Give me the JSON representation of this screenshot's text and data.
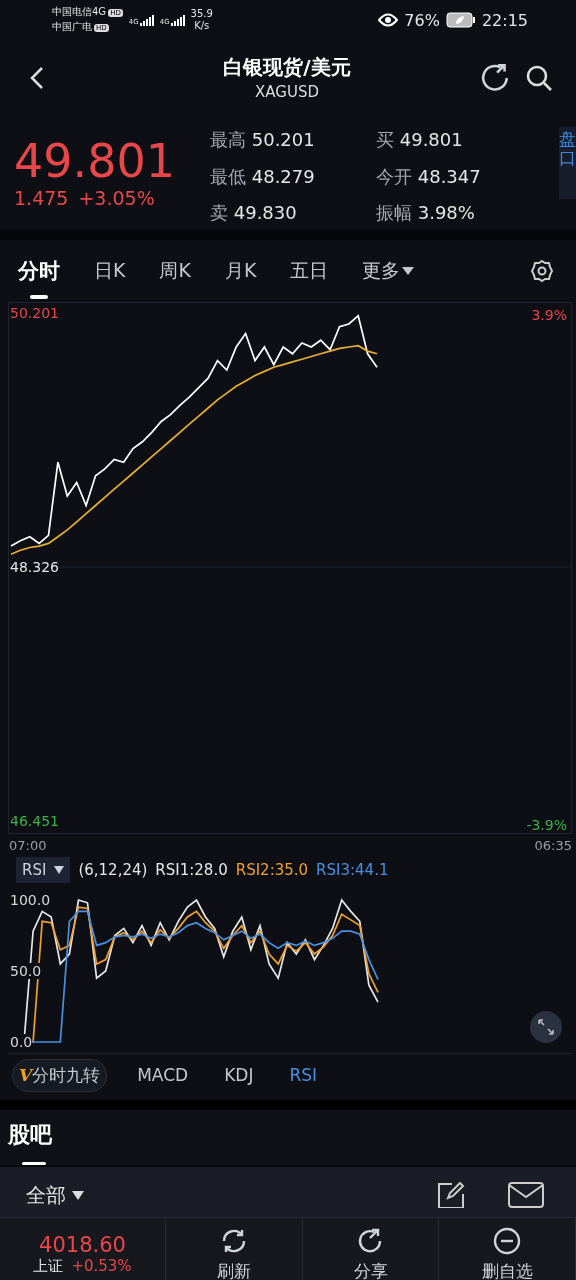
{
  "status_bar": {
    "carrier_1": "中国电信4G",
    "carrier_1_badge": "HD",
    "carrier_2": "中国广电",
    "carrier_2_badge": "HD",
    "net_1": "4G",
    "net_2": "4G",
    "speed": "35.9",
    "speed_unit": "K/s",
    "battery": "76%",
    "time": "22:15"
  },
  "header": {
    "title": "白银现货/美元",
    "subtitle": "XAGUSD"
  },
  "quote": {
    "price": "49.801",
    "change": "1.475",
    "change_pct": "+3.05%",
    "stats": [
      {
        "label": "最高",
        "value": "50.201"
      },
      {
        "label": "买",
        "value": "49.801"
      },
      {
        "label": "最低",
        "value": "48.279"
      },
      {
        "label": "今开",
        "value": "48.347"
      },
      {
        "label": "卖",
        "value": "49.830"
      },
      {
        "label": "振幅",
        "value": "3.98%"
      }
    ],
    "side_tab": "盘口"
  },
  "tabs": [
    {
      "label": "分时",
      "selected": true
    },
    {
      "label": "日K",
      "selected": false
    },
    {
      "label": "周K",
      "selected": false
    },
    {
      "label": "月K",
      "selected": false
    },
    {
      "label": "五日",
      "selected": false
    },
    {
      "label": "更多",
      "selected": false
    }
  ],
  "chart": {
    "top_pct": "3.9%",
    "bottom_pct": "-3.9%",
    "start_time": "07:00",
    "end_time": "06:35",
    "chart_data": {
      "type": "line",
      "ylim": [
        46.377,
        50.275
      ],
      "yticks": [
        {
          "value": 50.201,
          "label": "50.201"
        },
        {
          "value": 48.326,
          "label": "48.326"
        },
        {
          "value": 46.451,
          "label": "46.451"
        }
      ],
      "series": [
        {
          "color": "#ffffff",
          "values": [
            48.48,
            48.52,
            48.55,
            48.5,
            48.56,
            49.1,
            48.85,
            48.95,
            48.78,
            49.0,
            49.05,
            49.12,
            49.1,
            49.2,
            49.25,
            49.32,
            49.4,
            49.45,
            49.52,
            49.58,
            49.65,
            49.72,
            49.85,
            49.78,
            49.95,
            50.05,
            49.85,
            49.95,
            49.82,
            49.95,
            49.9,
            49.98,
            49.95,
            50.0,
            49.93,
            50.1,
            50.12,
            50.18,
            49.9,
            49.8
          ]
        },
        {
          "color": "#e8b030",
          "values": [
            48.42,
            48.45,
            48.47,
            48.48,
            48.5,
            48.55,
            48.6,
            48.66,
            48.72,
            48.78,
            48.84,
            48.9,
            48.96,
            49.02,
            49.08,
            49.14,
            49.2,
            49.26,
            49.32,
            49.38,
            49.44,
            49.5,
            49.56,
            49.61,
            49.66,
            49.7,
            49.74,
            49.77,
            49.8,
            49.82,
            49.84,
            49.86,
            49.88,
            49.9,
            49.92,
            49.94,
            49.95,
            49.96,
            49.92,
            49.9
          ]
        }
      ]
    }
  },
  "indicator": {
    "name": "RSI",
    "params": "(6,12,24)",
    "readings": [
      {
        "label": "RSI1:28.0",
        "color": "#e8e8e8"
      },
      {
        "label": "RSI2:35.0",
        "color": "#f0a030"
      },
      {
        "label": "RSI3:44.1",
        "color": "#4a90e2"
      }
    ],
    "chart_data": {
      "type": "line",
      "ylim": [
        0,
        100
      ],
      "yticks": [
        {
          "value": 100,
          "label": "100.0"
        },
        {
          "value": 50,
          "label": "50.0"
        },
        {
          "value": 0,
          "label": "0.0"
        }
      ],
      "series": [
        {
          "color": "#e8e8e8",
          "values": [
            0,
            78,
            92,
            88,
            55,
            62,
            100,
            98,
            45,
            50,
            75,
            80,
            70,
            82,
            68,
            84,
            72,
            85,
            95,
            100,
            88,
            80,
            60,
            78,
            88,
            65,
            82,
            55,
            45,
            70,
            62,
            72,
            58,
            68,
            80,
            100,
            92,
            85,
            40,
            28
          ]
        },
        {
          "color": "#f0a030",
          "values": [
            0,
            0,
            85,
            84,
            65,
            68,
            95,
            94,
            55,
            58,
            74,
            77,
            72,
            78,
            70,
            79,
            73,
            80,
            88,
            92,
            84,
            78,
            66,
            75,
            82,
            70,
            78,
            62,
            55,
            68,
            64,
            70,
            62,
            67,
            75,
            90,
            86,
            82,
            48,
            35
          ]
        },
        {
          "color": "#4a90e2",
          "values": [
            0,
            0,
            0,
            0,
            0,
            85,
            92,
            92,
            68,
            70,
            74,
            75,
            74,
            76,
            73,
            76,
            74,
            77,
            82,
            84,
            80,
            77,
            72,
            75,
            78,
            73,
            76,
            70,
            66,
            70,
            68,
            71,
            68,
            70,
            73,
            78,
            78,
            76,
            58,
            44
          ]
        }
      ]
    }
  },
  "indicator_tabs": [
    {
      "label": "分时九转",
      "badge": "V",
      "selected": false
    },
    {
      "label": "MACD",
      "selected": false
    },
    {
      "label": "KDJ",
      "selected": false
    },
    {
      "label": "RSI",
      "selected": true
    }
  ],
  "forum": {
    "title": "股吧",
    "filter": "全部"
  },
  "bottom_bar": {
    "index_value": "4018.60",
    "index_name": "上证",
    "index_change": "+0.53%",
    "actions": [
      {
        "label": "刷新",
        "kind": "refresh"
      },
      {
        "label": "分享",
        "kind": "share"
      },
      {
        "label": "删自选",
        "kind": "remove"
      }
    ]
  }
}
